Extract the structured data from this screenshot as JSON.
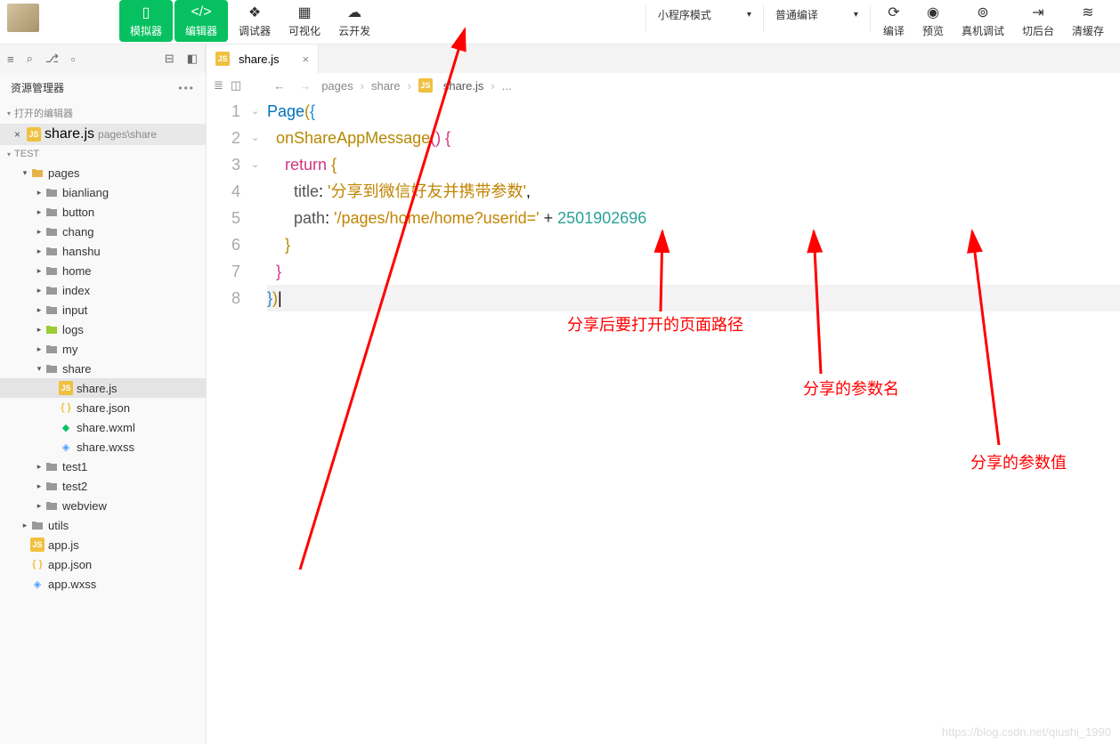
{
  "toolbar": {
    "simulator": "模拟器",
    "editor": "编辑器",
    "debugger": "调试器",
    "visualize": "可视化",
    "cloud": "云开发",
    "mode_dropdown": "小程序模式",
    "compile_dropdown": "普通编译",
    "compile": "编译",
    "preview": "预览",
    "real_debug": "真机调试",
    "background": "切后台",
    "clear_cache": "清缓存"
  },
  "sidebar": {
    "title": "资源管理器",
    "open_editors": "打开的编辑器",
    "project": "TEST",
    "open_file": {
      "name": "share.js",
      "path": "pages\\share"
    },
    "tree": [
      {
        "depth": 1,
        "caret": "open",
        "icon": "folder-o",
        "name": "pages"
      },
      {
        "depth": 2,
        "caret": "closed",
        "icon": "folder",
        "name": "bianliang"
      },
      {
        "depth": 2,
        "caret": "closed",
        "icon": "folder",
        "name": "button"
      },
      {
        "depth": 2,
        "caret": "closed",
        "icon": "folder",
        "name": "chang"
      },
      {
        "depth": 2,
        "caret": "closed",
        "icon": "folder",
        "name": "hanshu"
      },
      {
        "depth": 2,
        "caret": "closed",
        "icon": "folder",
        "name": "home"
      },
      {
        "depth": 2,
        "caret": "closed",
        "icon": "folder",
        "name": "index"
      },
      {
        "depth": 2,
        "caret": "closed",
        "icon": "folder",
        "name": "input"
      },
      {
        "depth": 2,
        "caret": "closed",
        "icon": "lime",
        "name": "logs"
      },
      {
        "depth": 2,
        "caret": "closed",
        "icon": "folder",
        "name": "my"
      },
      {
        "depth": 2,
        "caret": "open",
        "icon": "folder",
        "name": "share"
      },
      {
        "depth": 3,
        "caret": "",
        "icon": "js",
        "name": "share.js",
        "active": true
      },
      {
        "depth": 3,
        "caret": "",
        "icon": "json",
        "name": "share.json"
      },
      {
        "depth": 3,
        "caret": "",
        "icon": "wxml",
        "name": "share.wxml"
      },
      {
        "depth": 3,
        "caret": "",
        "icon": "wxss",
        "name": "share.wxss"
      },
      {
        "depth": 2,
        "caret": "closed",
        "icon": "folder",
        "name": "test1"
      },
      {
        "depth": 2,
        "caret": "closed",
        "icon": "folder",
        "name": "test2"
      },
      {
        "depth": 2,
        "caret": "closed",
        "icon": "folder",
        "name": "webview"
      },
      {
        "depth": 1,
        "caret": "closed",
        "icon": "folder",
        "name": "utils"
      },
      {
        "depth": 1,
        "caret": "",
        "icon": "js",
        "name": "app.js"
      },
      {
        "depth": 1,
        "caret": "",
        "icon": "json",
        "name": "app.json"
      },
      {
        "depth": 1,
        "caret": "",
        "icon": "wxss",
        "name": "app.wxss"
      }
    ]
  },
  "editor": {
    "tab": "share.js",
    "breadcrumbs": [
      "pages",
      "share",
      "share.js",
      "..."
    ],
    "code": {
      "page": "Page",
      "fn": "onShareAppMessage",
      "ret": "return",
      "title_key": "title",
      "title_val": "'分享到微信好友并携带参数'",
      "path_key": "path",
      "path_val": "'/pages/home/home?userid='",
      "num": "2501902696"
    }
  },
  "annotations": {
    "a1": "分享后要打开的页面路径",
    "a2": "分享的参数名",
    "a3": "分享的参数值"
  },
  "watermark": "https://blog.csdn.net/qiushi_1990"
}
